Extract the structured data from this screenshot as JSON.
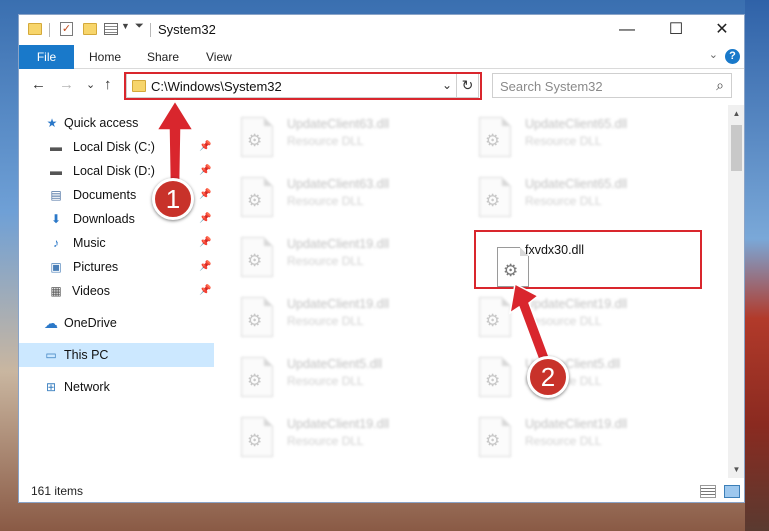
{
  "window": {
    "title": "System32",
    "minimize": "—",
    "maximize": "☐",
    "close": "✕"
  },
  "ribbon": {
    "tabs": [
      "File",
      "Home",
      "Share",
      "View"
    ],
    "help": "?",
    "collapse": "⌄"
  },
  "nav": {
    "back": "←",
    "forward": "→",
    "recent": "⌄",
    "up": "↑",
    "address": "C:\\Windows\\System32",
    "address_dropdown": "⌄",
    "refresh": "↻",
    "search_placeholder": "Search System32",
    "search_icon": "⌕"
  },
  "sidebar": {
    "items": [
      {
        "label": "Quick access",
        "icon": "★",
        "icon_name": "star-icon"
      },
      {
        "label": "Local Disk (C:)",
        "icon": "▬",
        "icon_name": "drive-icon",
        "pin": "📌"
      },
      {
        "label": "Local Disk (D:)",
        "icon": "▬",
        "icon_name": "drive-icon",
        "pin": "📌"
      },
      {
        "label": "Documents",
        "icon": "▤",
        "icon_name": "documents-icon",
        "pin": "📌"
      },
      {
        "label": "Downloads",
        "icon": "⬇",
        "icon_name": "downloads-icon",
        "pin": "📌"
      },
      {
        "label": "Music",
        "icon": "♪",
        "icon_name": "music-icon",
        "pin": "📌"
      },
      {
        "label": "Pictures",
        "icon": "▣",
        "icon_name": "pictures-icon",
        "pin": "📌"
      },
      {
        "label": "Videos",
        "icon": "▦",
        "icon_name": "videos-icon",
        "pin": "📌"
      },
      {
        "label": "OneDrive",
        "icon": "☁",
        "icon_name": "cloud-icon"
      },
      {
        "label": "This PC",
        "icon": "▭",
        "icon_name": "computer-icon"
      },
      {
        "label": "Network",
        "icon": "⊞",
        "icon_name": "network-icon"
      }
    ]
  },
  "files": [
    {
      "name": "UpdateClient63.dll",
      "type": "Resource DLL"
    },
    {
      "name": "UpdateClient65.dll",
      "type": "Resource DLL"
    },
    {
      "name": "UpdateClient63.dll",
      "type": "Resource DLL"
    },
    {
      "name": "UpdateClient65.dll",
      "type": "Resource DLL"
    },
    {
      "name": "UpdateClient19.dll",
      "type": "Resource DLL"
    },
    {
      "name": "fxvdx30.dll",
      "type": ""
    },
    {
      "name": "UpdateClient19.dll",
      "type": "Resource DLL"
    },
    {
      "name": "UpdateClient19.dll",
      "type": "Resource DLL"
    },
    {
      "name": "UpdateClient5.dll",
      "type": "Resource DLL"
    },
    {
      "name": "UpdateClient5.dll",
      "type": "Resource DLL"
    },
    {
      "name": "UpdateClient19.dll",
      "type": "Resource DLL"
    },
    {
      "name": "UpdateClient19.dll",
      "type": "Resource DLL"
    }
  ],
  "status": {
    "item_count": "161 items"
  },
  "annotations": {
    "step1": "1",
    "step2": "2",
    "color": "#d9262d"
  }
}
